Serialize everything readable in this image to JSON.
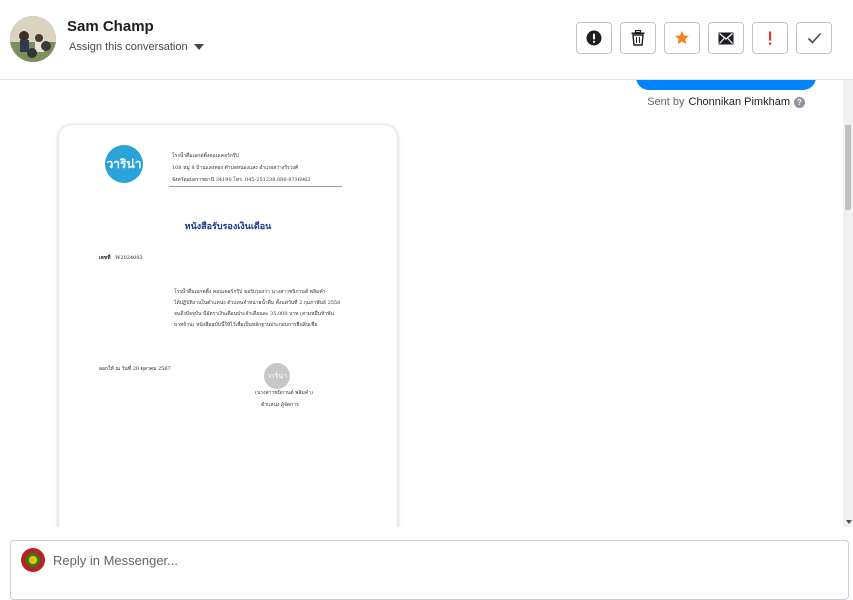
{
  "header": {
    "contact_name": "Sam Champ",
    "assign_label": "Assign this conversation",
    "actions": [
      {
        "name": "mark-spam-button",
        "icon": "alert-circle-icon"
      },
      {
        "name": "delete-button",
        "icon": "trash-icon"
      },
      {
        "name": "star-button",
        "icon": "star-icon",
        "color": "#f5821f"
      },
      {
        "name": "email-button",
        "icon": "envelope-icon"
      },
      {
        "name": "mark-important-button",
        "icon": "exclamation-icon",
        "color": "#e4332a"
      },
      {
        "name": "mark-done-button",
        "icon": "check-icon"
      }
    ]
  },
  "thread": {
    "outgoing_bubble_color": "#0084ff",
    "sent_by_prefix": "Sent by",
    "sent_by_name": "Chonnikan Pimkham",
    "sent_by_info_glyph": "?",
    "document": {
      "logo_text": "วาริน่า",
      "header_lines": [
        "โรงน้ำดื่มเอกตติ้งคอนเคอร์กรุ๊ป",
        "108 หมู่ 8 บ้านแสงทอง ตำบลหนองแสง อำเภอสว่างวีรวงศ์",
        "จังหวัดอุบลราชธานี 34190 โทร. 045-251238,086-8736963"
      ],
      "title": "หนังสือรับรองเงินเดือน",
      "doc_number_label": "เลขที่",
      "doc_number": "W2024003",
      "body_lines": [
        "โรงน้ำดื่มเอกตติ้ง คอนเคอร์กรุ๊ป ขอรับรองว่า นางสาวชนิกานต์ พลิมคำ",
        "ได้ปฏิบัติงานในตำแหน่ง ตัวแทนจำหน่ายน้ำดื่ม ตั้งแต่วันที่ 2 กุมภาพันธ์ 2558",
        "จนถึงปัจจุบัน มีอัตราเงินเดือนประจำเดือนละ 35,000 บาท (สามหมื่นห้าพัน",
        "บาทถ้วน) หนังสือฉบับนี้ให้ไว้เพื่อเป็นหลักฐานประกอบการยื่นสินเชื่อ"
      ],
      "issued_date": "ออกให้ ณ วันที่ 20 ตุลาคม 2567",
      "seal_text": "วาริน่า",
      "signature_lines": [
        "(นางสาวชนิกานต์ พลิมคำ)",
        "ตำแหน่ง ผู้จัดการ"
      ]
    }
  },
  "reply": {
    "placeholder": "Reply in Messenger..."
  }
}
